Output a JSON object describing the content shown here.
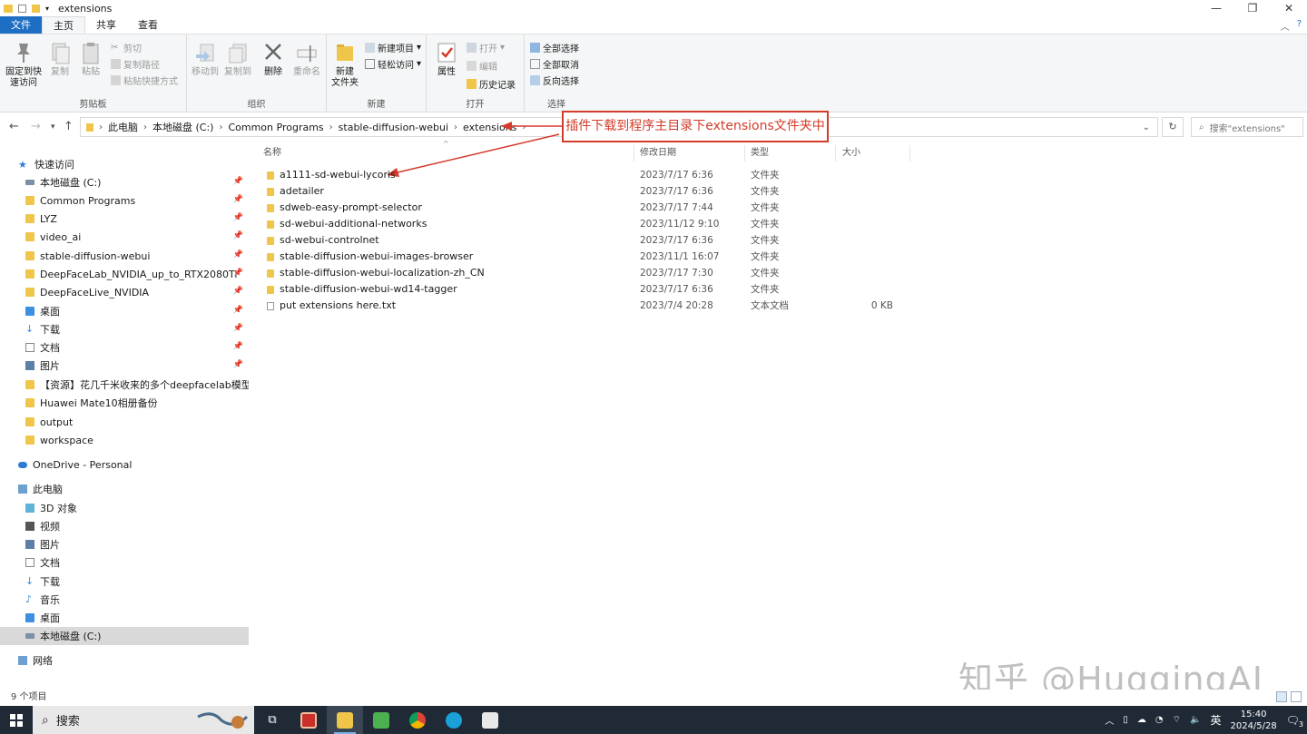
{
  "window": {
    "title": "extensions"
  },
  "ribbon_tabs": [
    "文件",
    "主页",
    "共享",
    "查看"
  ],
  "ribbon": {
    "clipboard": {
      "pin_label": "固定到快\n速访问",
      "copy": "复制",
      "paste": "粘贴",
      "cut": "剪切",
      "copy_path": "复制路径",
      "paste_shortcut": "粘贴快捷方式",
      "group": "剪贴板"
    },
    "organize": {
      "move_to": "移动到",
      "copy_to": "复制到",
      "delete": "删除",
      "rename": "重命名",
      "group": "组织"
    },
    "new": {
      "new_folder": "新建\n文件夹",
      "new_item": "新建项目",
      "easy_access": "轻松访问",
      "group": "新建"
    },
    "open": {
      "properties": "属性",
      "open": "打开",
      "edit": "编辑",
      "history": "历史记录",
      "group": "打开"
    },
    "select": {
      "select_all": "全部选择",
      "select_none": "全部取消",
      "invert": "反向选择",
      "group": "选择"
    }
  },
  "address": {
    "crumbs": [
      "此电脑",
      "本地磁盘 (C:)",
      "Common Programs",
      "stable-diffusion-webui",
      "extensions"
    ],
    "search_placeholder": "搜索\"extensions\""
  },
  "annotation": {
    "text": "插件下载到程序主目录下extensions文件夹中"
  },
  "sidebar": {
    "quick_access": "快速访问",
    "quick_items": [
      "本地磁盘 (C:)",
      "Common Programs",
      "LYZ",
      "video_ai",
      "stable-diffusion-webui",
      "DeepFaceLab_NVIDIA_up_to_RTX2080Ti",
      "DeepFaceLive_NVIDIA",
      "桌面",
      "下载",
      "文档",
      "图片",
      "【资源】花几千米收来的多个deepfacelab模型（模",
      "Huawei Mate10相册备份",
      "output",
      "workspace"
    ],
    "onedrive": "OneDrive - Personal",
    "this_pc": "此电脑",
    "pc_items": [
      "3D 对象",
      "视频",
      "图片",
      "文档",
      "下载",
      "音乐",
      "桌面",
      "本地磁盘 (C:)"
    ],
    "network": "网络"
  },
  "columns": {
    "name": "名称",
    "date": "修改日期",
    "type": "类型",
    "size": "大小"
  },
  "files": [
    {
      "name": "a1111-sd-webui-lycoris",
      "date": "2023/7/17 6:36",
      "type": "文件夹",
      "size": ""
    },
    {
      "name": "adetailer",
      "date": "2023/7/17 6:36",
      "type": "文件夹",
      "size": ""
    },
    {
      "name": "sdweb-easy-prompt-selector",
      "date": "2023/7/17 7:44",
      "type": "文件夹",
      "size": ""
    },
    {
      "name": "sd-webui-additional-networks",
      "date": "2023/11/12 9:10",
      "type": "文件夹",
      "size": ""
    },
    {
      "name": "sd-webui-controlnet",
      "date": "2023/7/17 6:36",
      "type": "文件夹",
      "size": ""
    },
    {
      "name": "stable-diffusion-webui-images-browser",
      "date": "2023/11/1 16:07",
      "type": "文件夹",
      "size": ""
    },
    {
      "name": "stable-diffusion-webui-localization-zh_CN",
      "date": "2023/7/17 7:30",
      "type": "文件夹",
      "size": ""
    },
    {
      "name": "stable-diffusion-webui-wd14-tagger",
      "date": "2023/7/17 6:36",
      "type": "文件夹",
      "size": ""
    },
    {
      "name": "put extensions here.txt",
      "date": "2023/7/4 20:28",
      "type": "文本文档",
      "size": "0 KB"
    }
  ],
  "status": {
    "count": "9 个项目"
  },
  "watermark": "知乎 @HuggingAI",
  "taskbar": {
    "search": "搜索",
    "ime": "英",
    "time": "15:40",
    "date": "2024/5/28",
    "notif": "3"
  },
  "colors": {
    "accent": "#1e6fc3",
    "annotation": "#d33b2a",
    "folder": "#f0c64a",
    "taskbar": "#1f2a36"
  }
}
